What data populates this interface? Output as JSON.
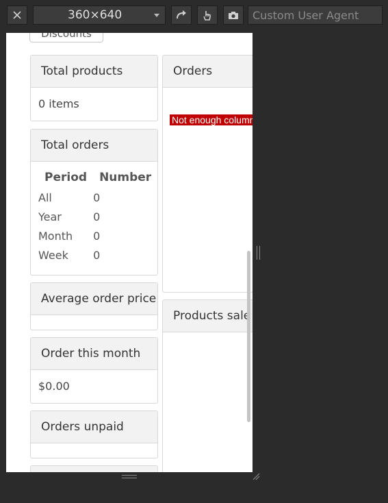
{
  "toolbar": {
    "device_size": "360×640",
    "user_agent_placeholder": "Custom User Agent",
    "icons": [
      "close-icon",
      "rotate-icon",
      "touch-icon",
      "camera-icon"
    ]
  },
  "page": {
    "discounts_button": "Discounts",
    "total_products": {
      "title": "Total products",
      "value": "0 items"
    },
    "total_orders": {
      "title": "Total orders",
      "headers": [
        "Period",
        "Number"
      ],
      "rows": [
        {
          "period": "All",
          "number": "0"
        },
        {
          "period": "Year",
          "number": "0"
        },
        {
          "period": "Month",
          "number": "0"
        },
        {
          "period": "Week",
          "number": "0"
        }
      ]
    },
    "average_order_price": {
      "title": "Average order price"
    },
    "order_this_month": {
      "title": "Order this month",
      "value": "$0.00"
    },
    "orders_unpaid": {
      "title": "Orders unpaid"
    },
    "orders_panel": {
      "title": "Orders",
      "alert": "Not enough columns given to draw the requested chart."
    },
    "products_sale_panel": {
      "title": "Products sale c"
    }
  },
  "colors": {
    "chrome_bg": "#2b2b2b",
    "alert_bg": "#c00000",
    "panel_head_bg": "#f2f2f2"
  }
}
